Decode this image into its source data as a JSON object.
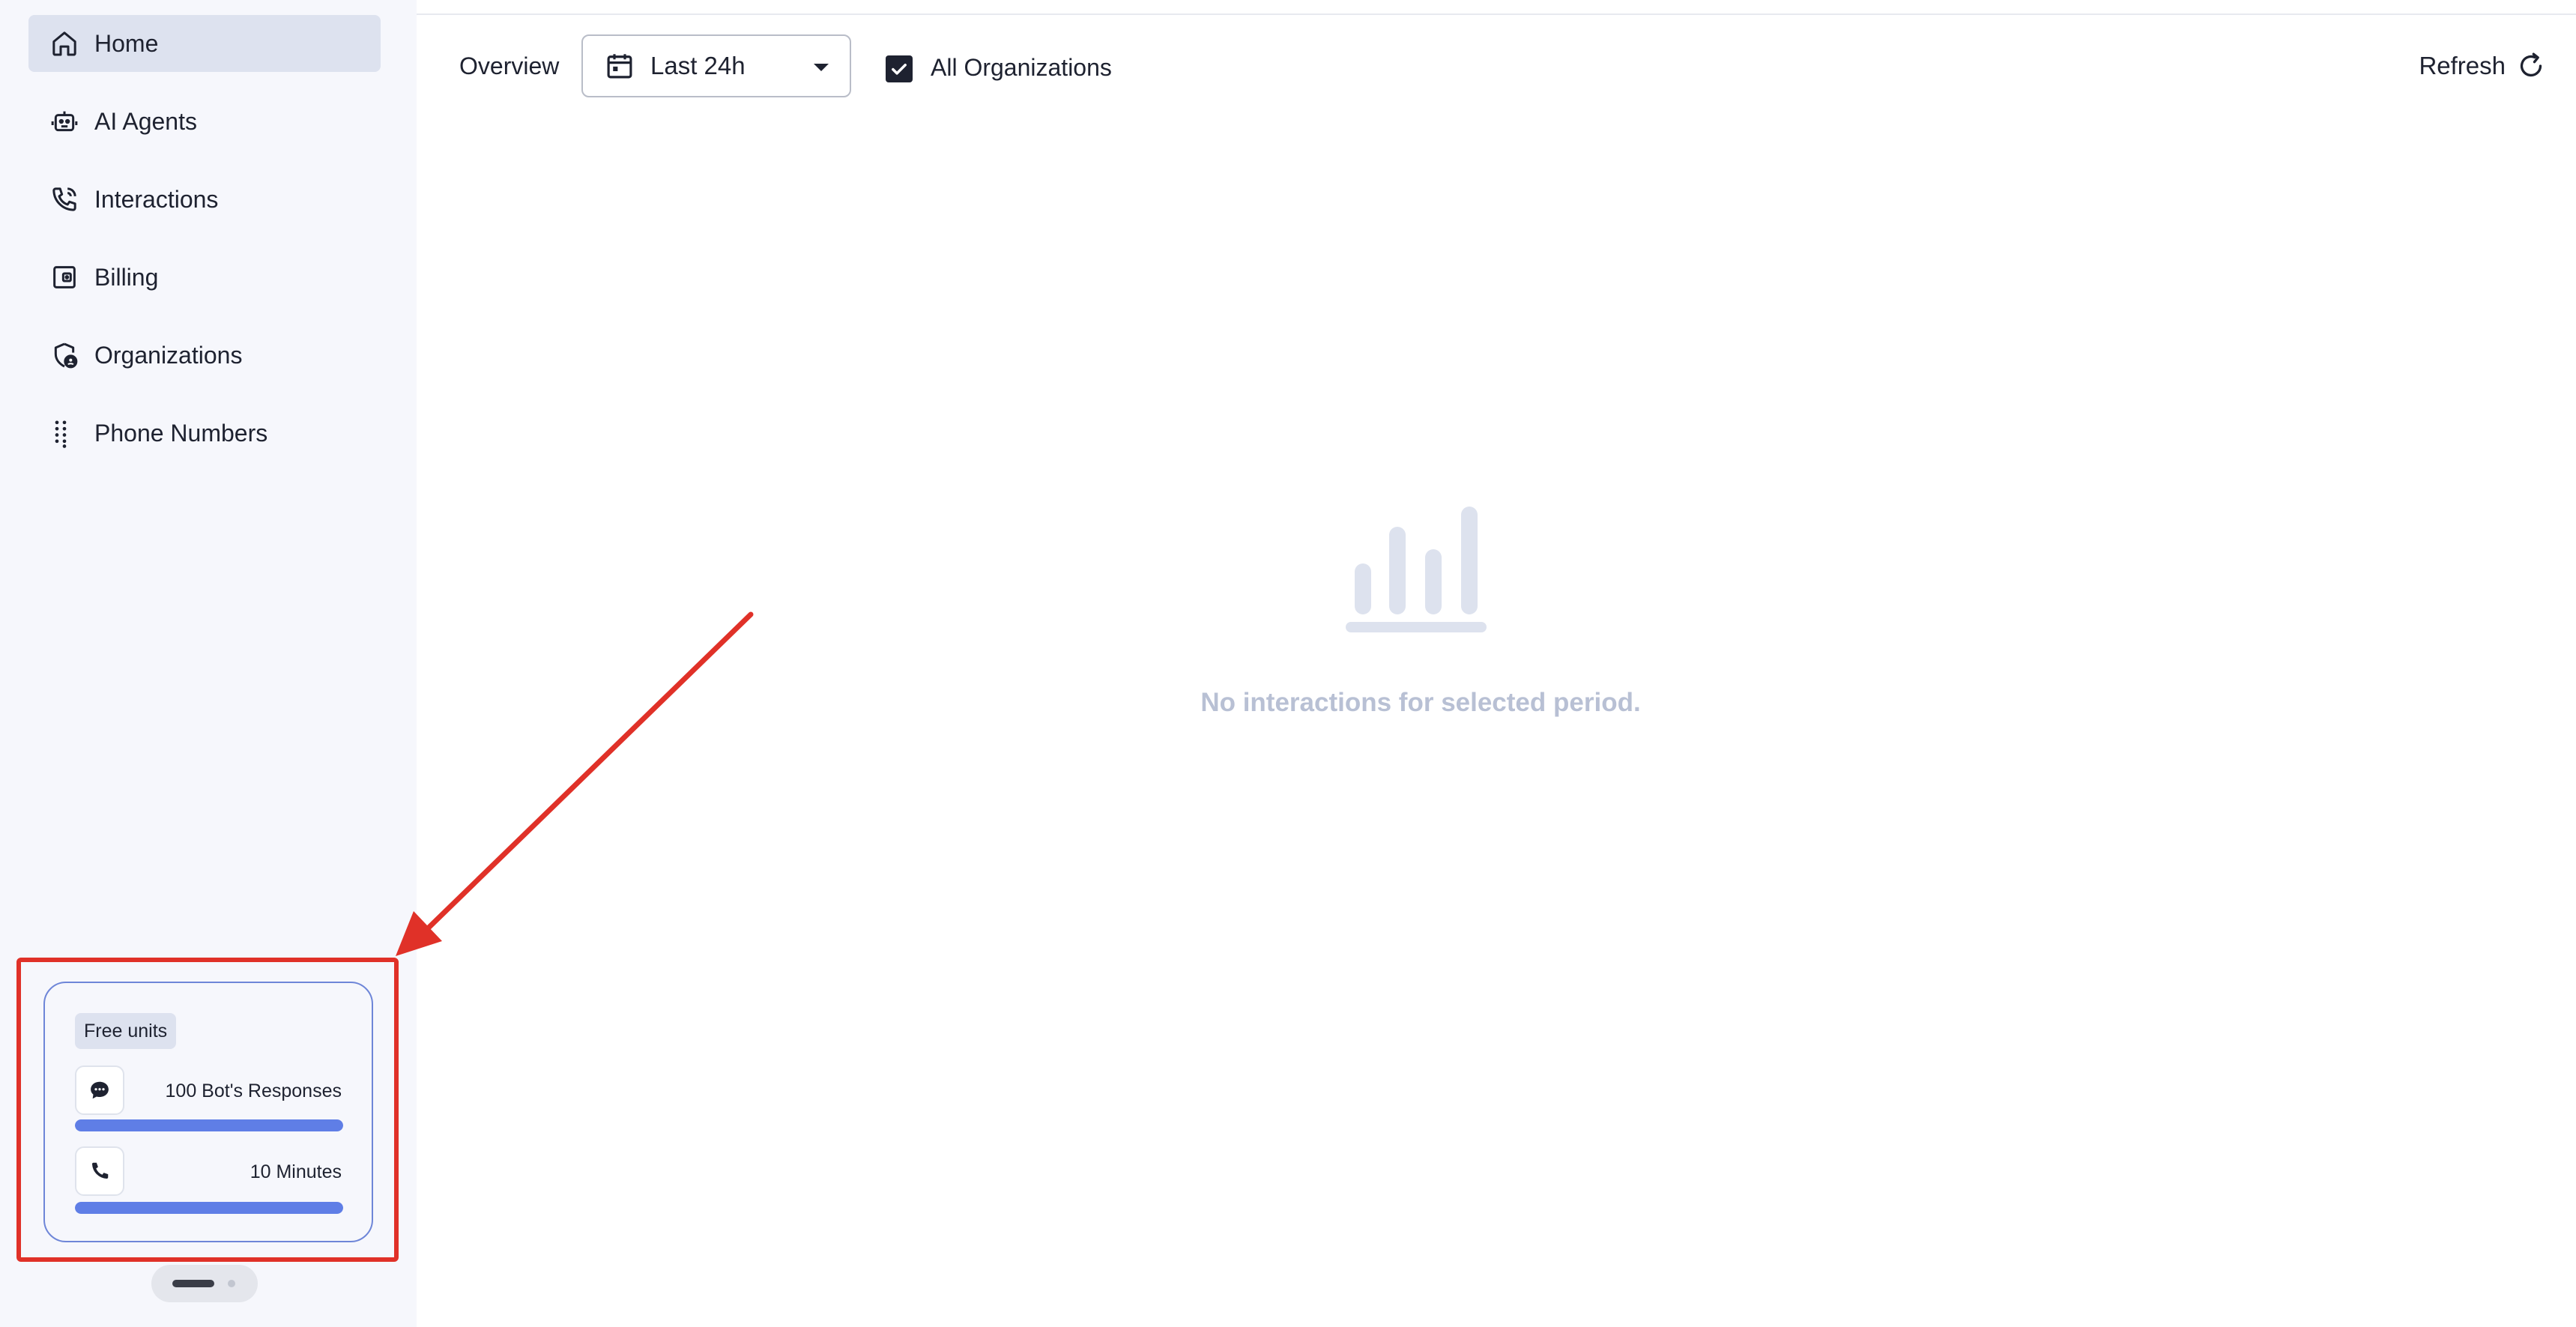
{
  "sidebar": {
    "items": [
      {
        "label": "Home",
        "icon": "home-icon",
        "active": true
      },
      {
        "label": "AI Agents",
        "icon": "robot-icon",
        "active": false
      },
      {
        "label": "Interactions",
        "icon": "phone-call-icon",
        "active": false
      },
      {
        "label": "Billing",
        "icon": "wallet-icon",
        "active": false
      },
      {
        "label": "Organizations",
        "icon": "shield-user-icon",
        "active": false
      },
      {
        "label": "Phone Numbers",
        "icon": "dialpad-icon",
        "active": false
      }
    ],
    "free_units": {
      "badge": "Free units",
      "bot_responses": {
        "label": "100 Bot's Responses",
        "icon": "chat-bubble-icon",
        "progress": 1.0
      },
      "minutes": {
        "label": "10 Minutes",
        "icon": "phone-icon",
        "progress": 1.0
      }
    }
  },
  "toolbar": {
    "overview_label": "Overview",
    "period": {
      "value": "Last 24h",
      "icon": "calendar-icon"
    },
    "all_orgs": {
      "label": "All Organizations",
      "checked": true
    },
    "refresh_label": "Refresh"
  },
  "empty_state": {
    "message": "No interactions for selected period.",
    "icon": "bar-chart-icon"
  },
  "colors": {
    "accent": "#5f7ee6",
    "annotation": "#e03128",
    "sidebar_bg": "#f6f7fc",
    "active_nav_bg": "#dde2ef",
    "empty_text": "#b8c0d4"
  }
}
